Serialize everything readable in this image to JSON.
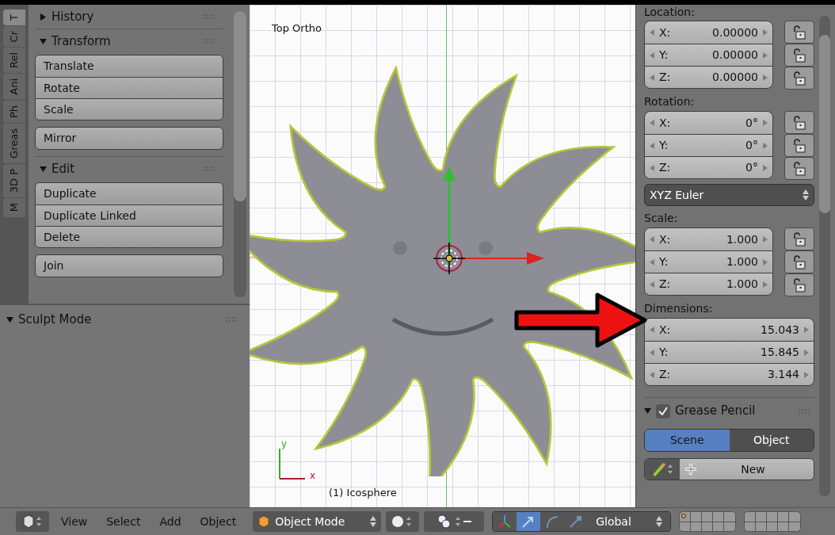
{
  "tool_tabs": [
    {
      "label": "T",
      "selected": true
    },
    {
      "label": "Cr",
      "selected": false
    },
    {
      "label": "Rel",
      "selected": false
    },
    {
      "label": "Ani",
      "selected": false
    },
    {
      "label": "Ph",
      "selected": false
    },
    {
      "label": "Greas",
      "selected": false
    },
    {
      "label": "3D P",
      "selected": false
    },
    {
      "label": "M",
      "selected": false
    }
  ],
  "tool_panels": [
    {
      "title": "History",
      "expanded": false
    },
    {
      "title": "Transform",
      "expanded": true,
      "button_groups": [
        [
          "Translate",
          "Rotate",
          "Scale"
        ],
        [
          "Mirror"
        ]
      ]
    },
    {
      "title": "Edit",
      "expanded": true,
      "button_groups": [
        [
          "Duplicate",
          "Duplicate Linked",
          "Delete"
        ],
        [
          "Join"
        ]
      ]
    }
  ],
  "sculpt_panel": {
    "title": "Sculpt Mode",
    "expanded": true
  },
  "viewport": {
    "view_label": "Top Ortho",
    "object_label": "(1) Icosphere",
    "axis_y": "y",
    "axis_x": "x"
  },
  "properties": {
    "groups": [
      {
        "label": "Location:",
        "fields": [
          {
            "axis": "X:",
            "value": "0.00000",
            "locked": false
          },
          {
            "axis": "Y:",
            "value": "0.00000",
            "locked": false
          },
          {
            "axis": "Z:",
            "value": "0.00000",
            "locked": false
          }
        ]
      },
      {
        "label": "Rotation:",
        "fields": [
          {
            "axis": "X:",
            "value": "0°",
            "locked": false
          },
          {
            "axis": "Y:",
            "value": "0°",
            "locked": false
          },
          {
            "axis": "Z:",
            "value": "0°",
            "locked": false
          }
        ],
        "mode": "XYZ Euler"
      },
      {
        "label": "Scale:",
        "fields": [
          {
            "axis": "X:",
            "value": "1.000",
            "locked": false
          },
          {
            "axis": "Y:",
            "value": "1.000",
            "locked": false
          },
          {
            "axis": "Z:",
            "value": "1.000",
            "locked": false
          }
        ]
      },
      {
        "label": "Dimensions:",
        "fields": [
          {
            "axis": "X:",
            "value": "15.043"
          },
          {
            "axis": "Y:",
            "value": "15.845"
          },
          {
            "axis": "Z:",
            "value": "3.144"
          }
        ]
      }
    ],
    "grease_pencil": {
      "title": "Grease Pencil",
      "expanded": true,
      "enabled": true,
      "source_tabs": [
        {
          "label": "Scene",
          "selected": true
        },
        {
          "label": "Object",
          "selected": false
        }
      ],
      "new_button": "New"
    }
  },
  "header": {
    "menus": [
      "View",
      "Select",
      "Add",
      "Object"
    ],
    "mode": "Object Mode",
    "orientation": "Global",
    "manipulators": [
      {
        "kind": "axes",
        "selected": false
      },
      {
        "kind": "translate",
        "selected": true
      },
      {
        "kind": "rotate",
        "selected": false
      },
      {
        "kind": "scale",
        "selected": false
      }
    ]
  }
}
